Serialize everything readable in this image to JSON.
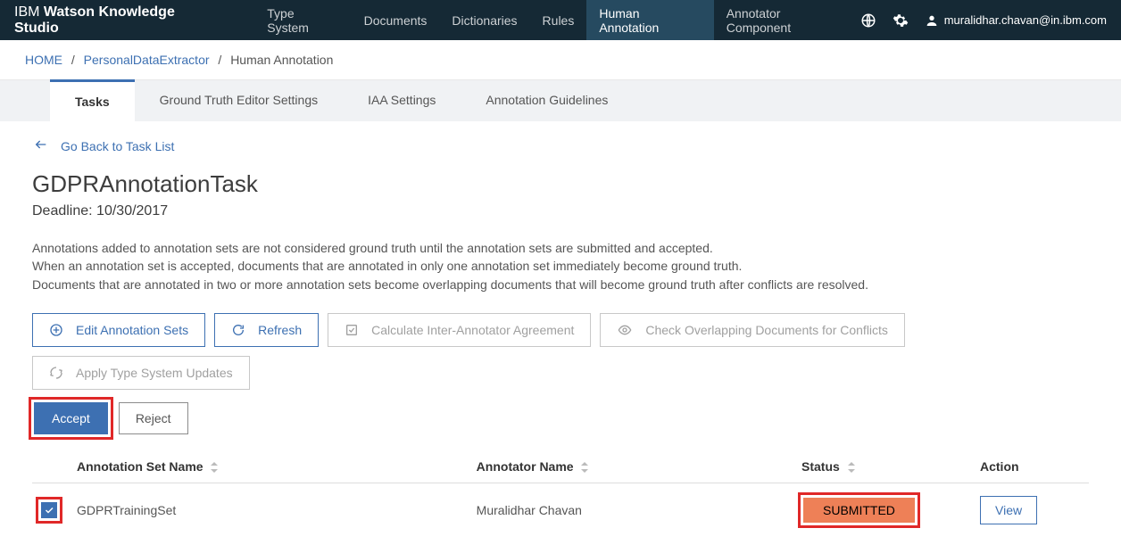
{
  "header": {
    "brand_prefix": "IBM ",
    "brand_main": "Watson Knowledge Studio",
    "nav": [
      {
        "label": "Type System"
      },
      {
        "label": "Documents"
      },
      {
        "label": "Dictionaries"
      },
      {
        "label": "Rules"
      },
      {
        "label": "Human Annotation",
        "active": true
      },
      {
        "label": "Annotator Component"
      }
    ],
    "user": "muralidhar.chavan@in.ibm.com"
  },
  "breadcrumb": {
    "home": "HOME",
    "project": "PersonalDataExtractor",
    "current": "Human Annotation"
  },
  "tabs": {
    "tasks": "Tasks",
    "gte": "Ground Truth Editor Settings",
    "iaa": "IAA Settings",
    "guidelines": "Annotation Guidelines"
  },
  "back_link": "Go Back to Task List",
  "task": {
    "title": "GDPRAnnotationTask",
    "deadline": "Deadline: 10/30/2017"
  },
  "description": {
    "line1": "Annotations added to annotation sets are not considered ground truth until the annotation sets are submitted and accepted.",
    "line2": "When an annotation set is accepted, documents that are annotated in only one annotation set immediately become ground truth.",
    "line3": "Documents that are annotated in two or more annotation sets become overlapping documents that will become ground truth after conflicts are resolved."
  },
  "buttons": {
    "edit_sets": "Edit Annotation Sets",
    "refresh": "Refresh",
    "calc_iaa": "Calculate Inter-Annotator Agreement",
    "check_conflicts": "Check Overlapping Documents for Conflicts",
    "apply_updates": "Apply Type System Updates",
    "accept": "Accept",
    "reject": "Reject"
  },
  "table": {
    "headers": {
      "set_name": "Annotation Set Name",
      "annotator": "Annotator Name",
      "status": "Status",
      "action": "Action"
    },
    "row": {
      "set_name": "GDPRTrainingSet",
      "annotator": "Muralidhar Chavan",
      "status": "SUBMITTED",
      "view": "View"
    }
  }
}
